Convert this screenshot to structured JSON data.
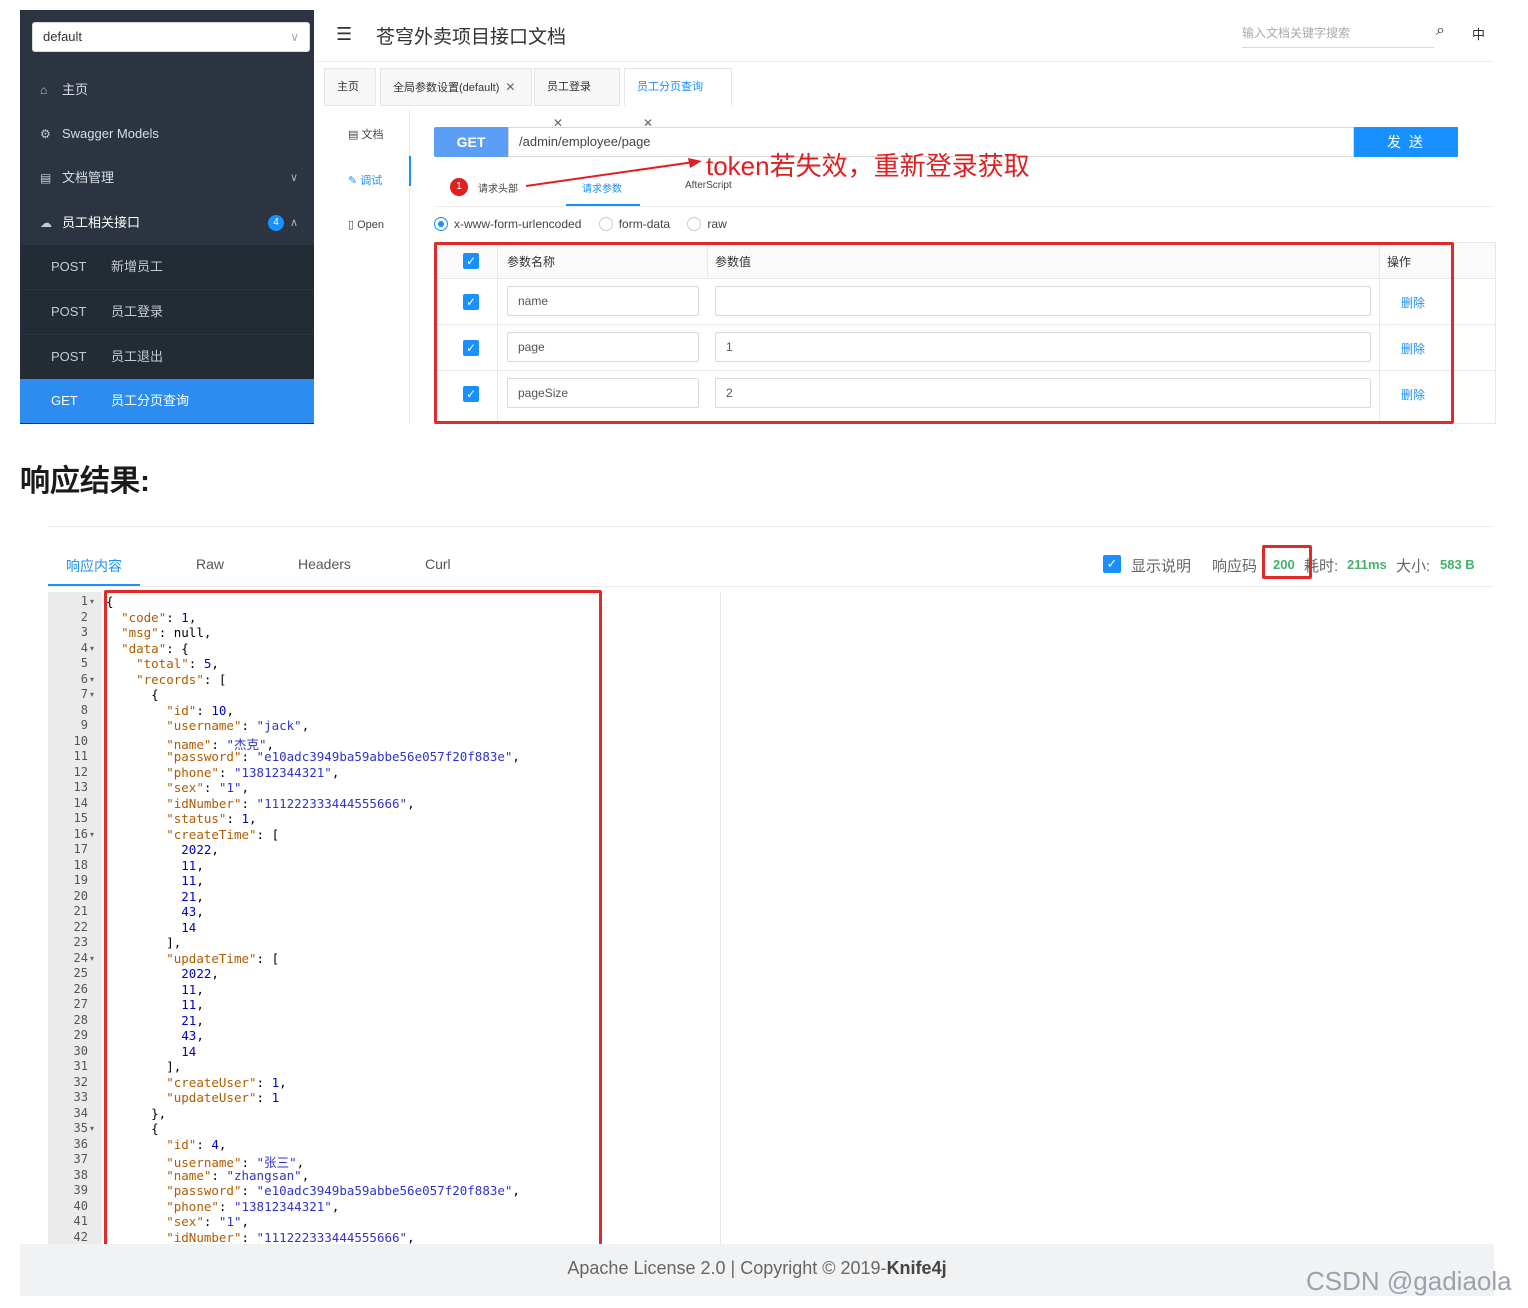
{
  "sidebar": {
    "group_select": "default",
    "items": [
      {
        "label": "主页",
        "icon": "home-icon"
      },
      {
        "label": "Swagger Models",
        "icon": "models-icon"
      },
      {
        "label": "文档管理",
        "icon": "doc-manage-icon"
      },
      {
        "label": "员工相关接口",
        "icon": "cloud-icon",
        "badge": "4"
      }
    ],
    "apis": [
      {
        "method": "POST",
        "name": "新增员工"
      },
      {
        "method": "POST",
        "name": "员工登录"
      },
      {
        "method": "POST",
        "name": "员工退出"
      },
      {
        "method": "GET",
        "name": "员工分页查询",
        "active": true
      }
    ]
  },
  "header": {
    "title": "苍穹外卖项目接口文档",
    "search_placeholder": "输入文档关键字搜索",
    "lang": "中"
  },
  "tabs": [
    {
      "label": "主页",
      "closable": false
    },
    {
      "label": "全局参数设置(default)",
      "closable": true
    },
    {
      "label": "员工登录",
      "closable": true
    },
    {
      "label": "员工分页查询",
      "closable": true,
      "active": true
    }
  ],
  "side_tabs": [
    {
      "label": "文档",
      "icon": "doc-icon"
    },
    {
      "label": "调试",
      "icon": "debug-icon",
      "active": true
    },
    {
      "label": "Open",
      "icon": "open-icon"
    }
  ],
  "request": {
    "method": "GET",
    "url": "/admin/employee/page",
    "send_label": "发 送",
    "annotation": "token若失效，重新登录获取",
    "param_tabs": [
      "请求头部",
      "请求参数",
      "AfterScript"
    ],
    "header_count": "1",
    "content_types": [
      "x-www-form-urlencoded",
      "form-data",
      "raw"
    ],
    "selected_content_type": "x-www-form-urlencoded",
    "columns": [
      "参数名称",
      "参数值",
      "操作"
    ],
    "params": [
      {
        "name": "name",
        "value": "",
        "action": "删除"
      },
      {
        "name": "page",
        "value": "1",
        "action": "删除"
      },
      {
        "name": "pageSize",
        "value": "2",
        "action": "删除"
      }
    ]
  },
  "section_title": "响应结果:",
  "response": {
    "tabs": [
      "响应内容",
      "Raw",
      "Headers",
      "Curl"
    ],
    "show_desc_label": "显示说明",
    "code_label": "响应码",
    "code": "200",
    "time_label": "耗时:",
    "time": "211ms",
    "size_label": "大小:",
    "size": "583 B",
    "lines": [
      "{",
      "  \"code\": 1,",
      "  \"msg\": null,",
      "  \"data\": {",
      "    \"total\": 5,",
      "    \"records\": [",
      "      {",
      "        \"id\": 10,",
      "        \"username\": \"jack\",",
      "        \"name\": \"杰克\",",
      "        \"password\": \"e10adc3949ba59abbe56e057f20f883e\",",
      "        \"phone\": \"13812344321\",",
      "        \"sex\": \"1\",",
      "        \"idNumber\": \"111222333444555666\",",
      "        \"status\": 1,",
      "        \"createTime\": [",
      "          2022,",
      "          11,",
      "          11,",
      "          21,",
      "          43,",
      "          14",
      "        ],",
      "        \"updateTime\": [",
      "          2022,",
      "          11,",
      "          11,",
      "          21,",
      "          43,",
      "          14",
      "        ],",
      "        \"createUser\": 1,",
      "        \"updateUser\": 1",
      "      },",
      "      {",
      "        \"id\": 4,",
      "        \"username\": \"张三\",",
      "        \"name\": \"zhangsan\",",
      "        \"password\": \"e10adc3949ba59abbe56e057f20f883e\",",
      "        \"phone\": \"13812344321\",",
      "        \"sex\": \"1\",",
      "        \"idNumber\": \"111222333444555666\","
    ],
    "foldable_lines": [
      1,
      4,
      6,
      7,
      16,
      24,
      35
    ]
  },
  "footer": {
    "license": "Apache License 2.0 | Copyright ",
    "copyright_symbol": "©",
    "year": " 2019-",
    "brand": "Knife4j"
  },
  "watermark": "CSDN @gadiaola",
  "colors": {
    "sidebar_bg": "#2b3440",
    "accent": "#1890ff",
    "annotation_red": "#e02020",
    "success_green": "#44b36a"
  }
}
